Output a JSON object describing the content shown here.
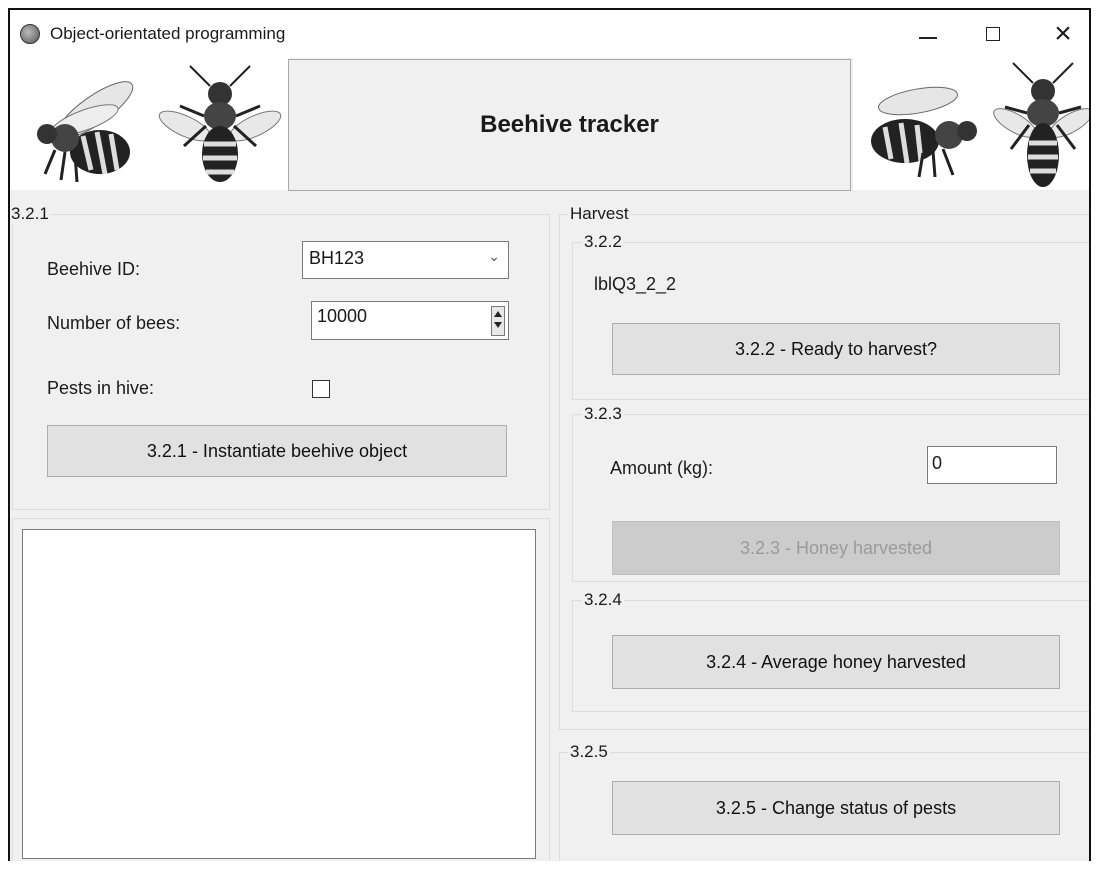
{
  "window": {
    "title": "Object-orientated programming",
    "minimize_label": "",
    "maximize_label": "",
    "close_label": "×"
  },
  "header": {
    "title": "Beehive tracker"
  },
  "group_321": {
    "label": "3.2.1",
    "beehive_id_label": "Beehive ID:",
    "beehive_id_value": "BH123",
    "bees_label": "Number of bees:",
    "bees_value": "10000",
    "pests_label": "Pests in hive:",
    "pests_checked": false,
    "instantiate_button": "3.2.1 - Instantiate beehive object"
  },
  "output_list": {
    "items": []
  },
  "harvest": {
    "label": "Harvest",
    "group_322": {
      "label": "3.2.2",
      "status_label": "lblQ3_2_2",
      "button": "3.2.2 - Ready to harvest?"
    },
    "group_323": {
      "label": "3.2.3",
      "amount_label": "Amount (kg):",
      "amount_value": "0",
      "button": "3.2.3 - Honey harvested",
      "button_enabled": false
    },
    "group_324": {
      "label": "3.2.4",
      "button": "3.2.4 - Average honey harvested"
    }
  },
  "group_325": {
    "label": "3.2.5",
    "button": "3.2.5 - Change status of pests"
  },
  "icons": [
    "app-icon",
    "minimize-icon",
    "maximize-icon",
    "close-icon",
    "chevron-down-icon",
    "spin-up-icon",
    "spin-down-icon",
    "bee-icon"
  ]
}
